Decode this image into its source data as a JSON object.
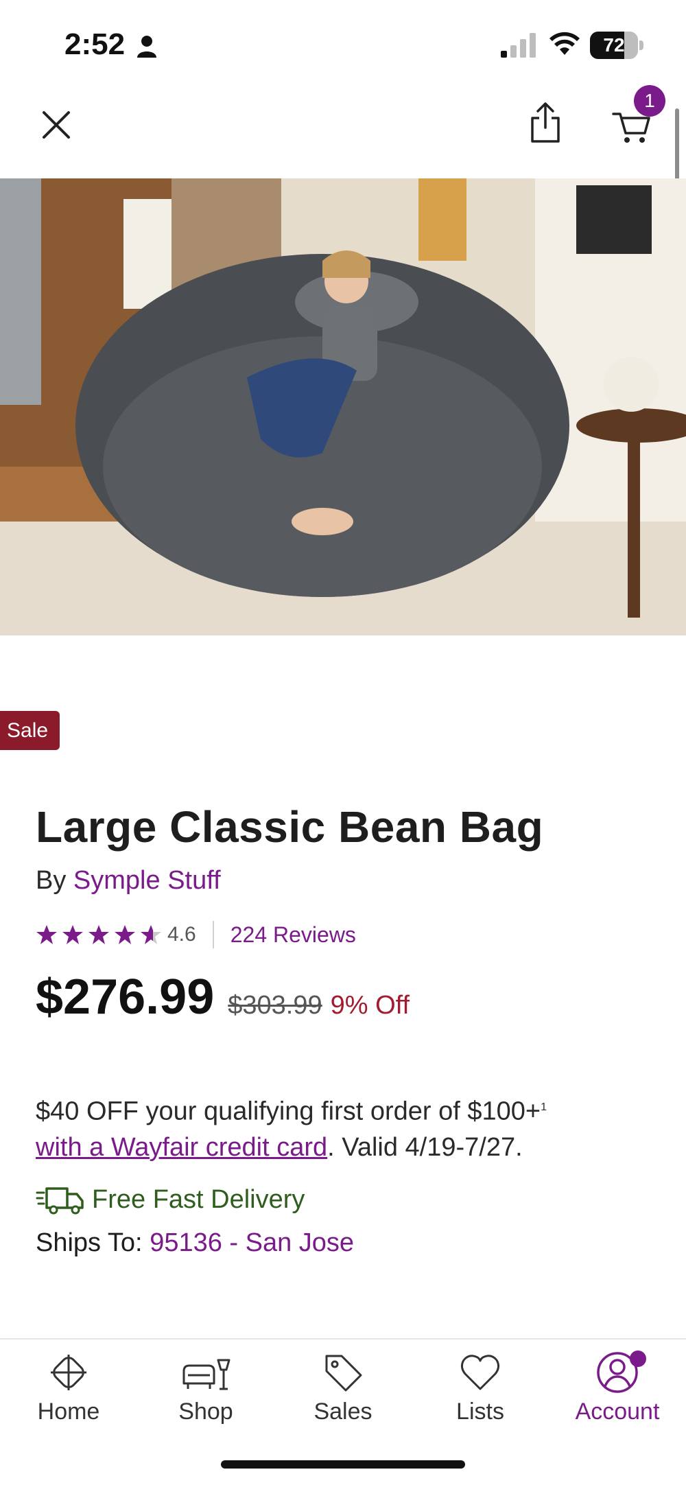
{
  "status_bar": {
    "time": "2:52",
    "battery": "72",
    "battery_level": 0.72
  },
  "header": {
    "cart_count": "1"
  },
  "product": {
    "badge": "Sale",
    "title": "Large Classic Bean Bag",
    "brand_prefix": "By",
    "brand": "Symple Stuff",
    "rating": "4.6",
    "rating_value": 4.6,
    "reviews": "224 Reviews",
    "price": "$276.99",
    "old_price": "$303.99",
    "discount": "9% Off"
  },
  "promo": {
    "text_before": "$40 OFF your qualifying first order of $100+",
    "footnote": "1",
    "link_text": "with a Wayfair credit card",
    "text_after": ". Valid 4/19-7/27."
  },
  "delivery": {
    "label": "Free Fast Delivery",
    "ships_prefix": "Ships To:",
    "location": "95136 - San Jose"
  },
  "bottom_nav": {
    "items": [
      {
        "label": "Home",
        "icon": "home-icon"
      },
      {
        "label": "Shop",
        "icon": "shop-icon"
      },
      {
        "label": "Sales",
        "icon": "sales-tag-icon"
      },
      {
        "label": "Lists",
        "icon": "heart-icon"
      },
      {
        "label": "Account",
        "icon": "account-icon"
      }
    ],
    "active": "Account"
  },
  "colors": {
    "brand_purple": "#7b1a8a",
    "sale_red": "#8b1a2b",
    "discount_red": "#a31b2f",
    "delivery_green": "#2f5d1e"
  }
}
